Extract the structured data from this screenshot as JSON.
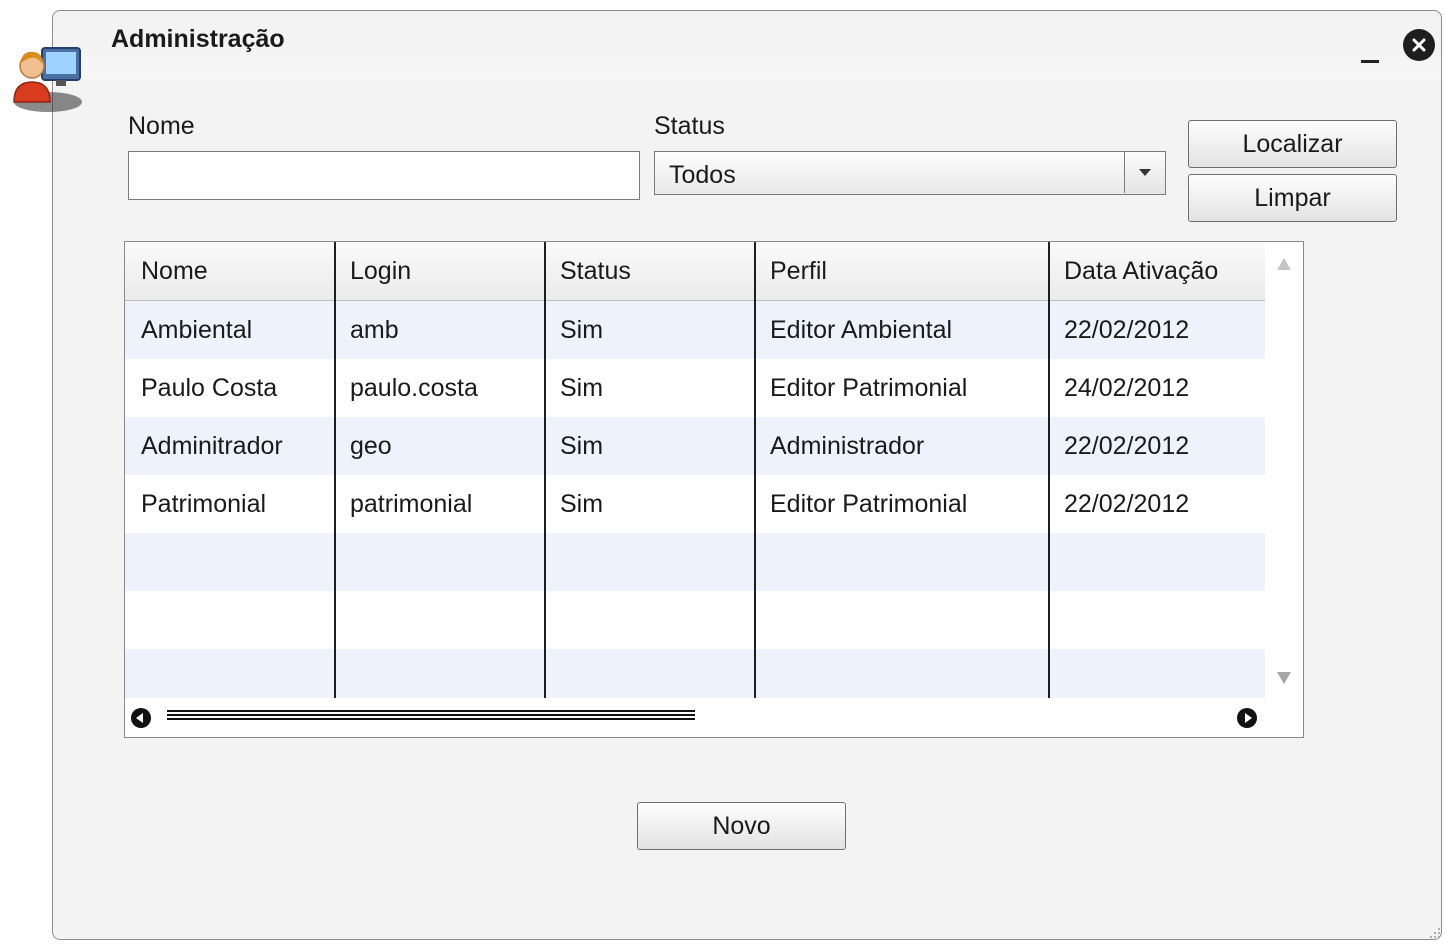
{
  "window": {
    "title": "Administração"
  },
  "filters": {
    "nome_label": "Nome",
    "nome_value": "",
    "status_label": "Status",
    "status_value": "Todos"
  },
  "buttons": {
    "localizar": "Localizar",
    "limpar": "Limpar",
    "novo": "Novo"
  },
  "table": {
    "columns": [
      "Nome",
      "Login",
      "Status",
      "Perfil",
      "Data Ativação"
    ],
    "rows": [
      [
        "Ambiental",
        "amb",
        "Sim",
        "Editor Ambiental",
        "22/02/2012"
      ],
      [
        "Paulo Costa",
        "paulo.costa",
        "Sim",
        "Editor Patrimonial",
        "24/02/2012"
      ],
      [
        "Adminitrador",
        "geo",
        "Sim",
        "Administrador",
        "22/02/2012"
      ],
      [
        "Patrimonial",
        "patrimonial",
        "Sim",
        "Editor Patrimonial",
        "22/02/2012"
      ]
    ]
  },
  "colors": {
    "row_alt": "#eef3fb",
    "window_bg": "#f3f3f3"
  }
}
